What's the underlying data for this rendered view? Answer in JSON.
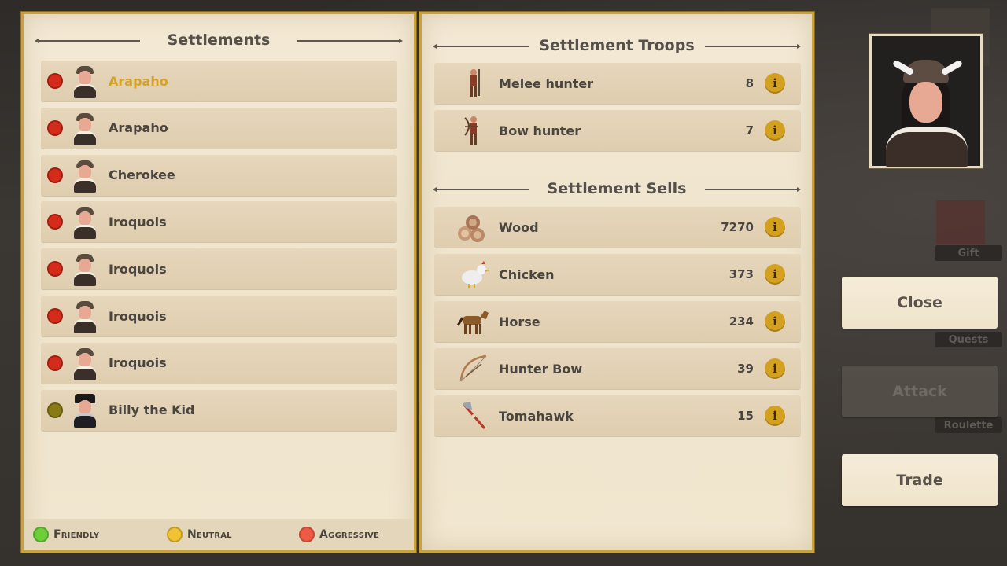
{
  "settlements_panel": {
    "title": "Settlements",
    "items": [
      {
        "name": "Arapaho",
        "status_color": "#d42b1a",
        "portrait": "native-chief-portrait",
        "selected": true
      },
      {
        "name": "Arapaho",
        "status_color": "#d42b1a",
        "portrait": "native-chief-portrait",
        "selected": false
      },
      {
        "name": "Cherokee",
        "status_color": "#d42b1a",
        "portrait": "native-chief-portrait",
        "selected": false
      },
      {
        "name": "Iroquois",
        "status_color": "#d42b1a",
        "portrait": "native-chief-portrait",
        "selected": false
      },
      {
        "name": "Iroquois",
        "status_color": "#d42b1a",
        "portrait": "native-chief-portrait",
        "selected": false
      },
      {
        "name": "Iroquois",
        "status_color": "#d42b1a",
        "portrait": "native-chief-portrait",
        "selected": false
      },
      {
        "name": "Iroquois",
        "status_color": "#d42b1a",
        "portrait": "native-chief-portrait",
        "selected": false
      },
      {
        "name": "Billy the Kid",
        "status_color": "#8a7a14",
        "portrait": "cowboy-portrait",
        "selected": false
      }
    ],
    "legend": [
      {
        "label": "Friendly",
        "color": "#6ccf3a"
      },
      {
        "label": "Neutral",
        "color": "#f1c232"
      },
      {
        "label": "Aggressive",
        "color": "#ef5a44"
      }
    ]
  },
  "troops_panel": {
    "title": "Settlement Troops",
    "items": [
      {
        "name": "Melee hunter",
        "count": "8",
        "icon": "melee-hunter-icon"
      },
      {
        "name": "Bow hunter",
        "count": "7",
        "icon": "bow-hunter-icon"
      }
    ]
  },
  "sells_panel": {
    "title": "Settlement Sells",
    "items": [
      {
        "name": "Wood",
        "count": "7270",
        "icon": "wood-icon"
      },
      {
        "name": "Chicken",
        "count": "373",
        "icon": "chicken-icon"
      },
      {
        "name": "Horse",
        "count": "234",
        "icon": "horse-icon"
      },
      {
        "name": "Hunter Bow",
        "count": "39",
        "icon": "bow-icon"
      },
      {
        "name": "Tomahawk",
        "count": "15",
        "icon": "tomahawk-icon"
      }
    ]
  },
  "info_glyph": "i",
  "actions": {
    "close": "Close",
    "attack": "Attack",
    "trade": "Trade"
  },
  "background_labels": {
    "gift": "Gift",
    "quests": "Quests",
    "roulette": "Roulette"
  },
  "colors": {
    "selected_name": "#d6a220",
    "panel_border": "#c9a23d",
    "info_button": "#d4a020"
  }
}
